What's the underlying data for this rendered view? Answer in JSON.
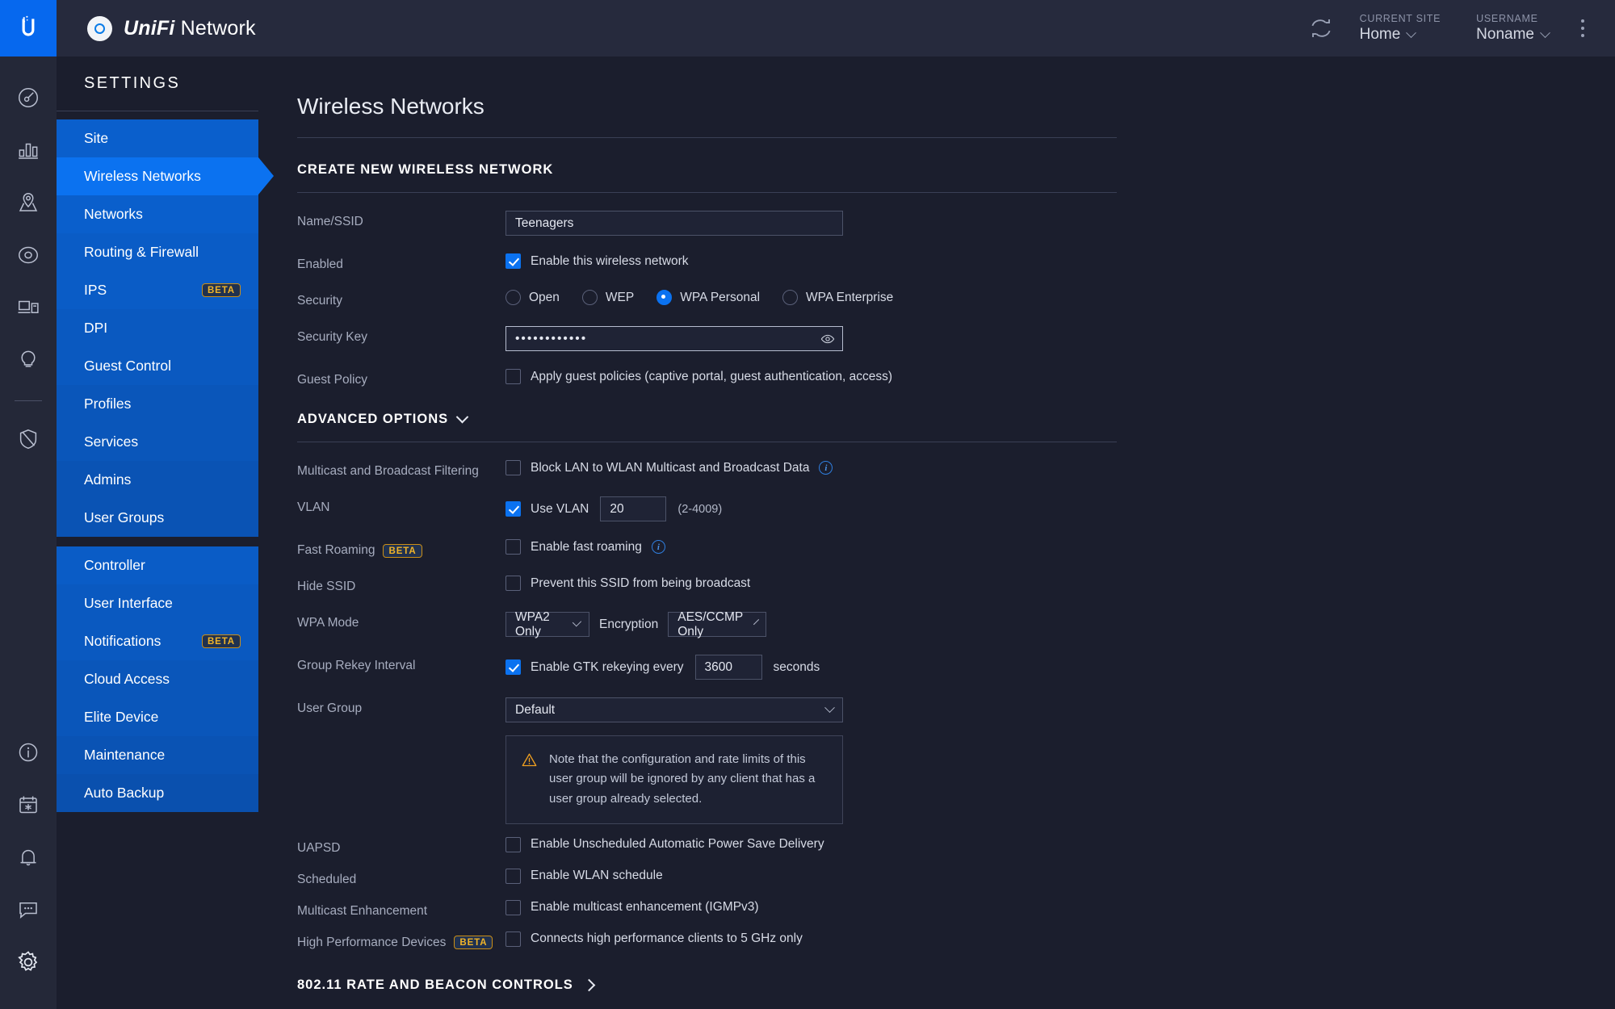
{
  "topbar": {
    "brand_bold": "UniFi",
    "brand_rest": " Network",
    "refresh_icon": "refresh-icon",
    "site_caption": "CURRENT SITE",
    "site_value": "Home",
    "user_caption": "USERNAME",
    "user_value": "Noname",
    "menu_icon": "kebab-menu-icon"
  },
  "rail": {
    "items": [
      {
        "name": "dashboard-icon"
      },
      {
        "name": "statistics-icon"
      },
      {
        "name": "map-icon"
      },
      {
        "name": "devices-icon"
      },
      {
        "name": "clients-icon"
      },
      {
        "name": "insights-icon"
      }
    ],
    "items_after_divider": [
      {
        "name": "threat-management-icon"
      }
    ],
    "bottom_items": [
      {
        "name": "info-icon"
      },
      {
        "name": "events-icon"
      },
      {
        "name": "alerts-icon"
      },
      {
        "name": "chat-icon"
      },
      {
        "name": "settings-gear-icon"
      }
    ]
  },
  "nav": {
    "title": "SETTINGS",
    "group1": [
      {
        "label": "Site",
        "badge": null,
        "active": false
      },
      {
        "label": "Wireless Networks",
        "badge": null,
        "active": true
      },
      {
        "label": "Networks",
        "badge": null,
        "active": false
      },
      {
        "label": "Routing & Firewall",
        "badge": null,
        "active": false
      },
      {
        "label": "IPS",
        "badge": "BETA",
        "active": false
      },
      {
        "label": "DPI",
        "badge": null,
        "active": false
      },
      {
        "label": "Guest Control",
        "badge": null,
        "active": false
      },
      {
        "label": "Profiles",
        "badge": null,
        "active": false
      },
      {
        "label": "Services",
        "badge": null,
        "active": false
      },
      {
        "label": "Admins",
        "badge": null,
        "active": false
      },
      {
        "label": "User Groups",
        "badge": null,
        "active": false
      }
    ],
    "group2": [
      {
        "label": "Controller",
        "badge": null,
        "active": false
      },
      {
        "label": "User Interface",
        "badge": null,
        "active": false
      },
      {
        "label": "Notifications",
        "badge": "BETA",
        "active": false
      },
      {
        "label": "Cloud Access",
        "badge": null,
        "active": false
      },
      {
        "label": "Elite Device",
        "badge": null,
        "active": false
      },
      {
        "label": "Maintenance",
        "badge": null,
        "active": false
      },
      {
        "label": "Auto Backup",
        "badge": null,
        "active": false
      }
    ]
  },
  "main": {
    "page_title": "Wireless Networks",
    "create_section_title": "CREATE NEW WIRELESS NETWORK",
    "name_label": "Name/SSID",
    "name_value": "Teenagers",
    "name_placeholder": "Name/SSID",
    "enabled_label": "Enabled",
    "enabled_checkbox_label": "Enable this wireless network",
    "enabled_checked": true,
    "security_label": "Security",
    "security_options": [
      {
        "label": "Open",
        "selected": false
      },
      {
        "label": "WEP",
        "selected": false
      },
      {
        "label": "WPA Personal",
        "selected": true
      },
      {
        "label": "WPA Enterprise",
        "selected": false
      }
    ],
    "security_key_label": "Security Key",
    "security_key_value": "••••••••••••",
    "security_key_reveal_icon": "eye-icon",
    "guest_policy_label": "Guest Policy",
    "guest_policy_checkbox_label": "Apply guest policies (captive portal, guest authentication, access)",
    "guest_policy_checked": false,
    "advanced_title": "ADVANCED OPTIONS",
    "advanced_chevron_icon": "chevron-down-icon",
    "multicast_label": "Multicast and Broadcast Filtering",
    "multicast_checkbox_label": "Block LAN to WLAN Multicast and Broadcast Data",
    "multicast_checked": false,
    "multicast_info_icon": "info-icon",
    "vlan_label": "VLAN",
    "vlan_checkbox_label": "Use VLAN",
    "vlan_checked": true,
    "vlan_value": "20",
    "vlan_range_hint": "(2-4009)",
    "fast_roaming_label": "Fast Roaming",
    "fast_roaming_badge": "BETA",
    "fast_roaming_checkbox_label": "Enable fast roaming",
    "fast_roaming_checked": false,
    "fast_roaming_info_icon": "info-icon",
    "hide_ssid_label": "Hide SSID",
    "hide_ssid_checkbox_label": "Prevent this SSID from being broadcast",
    "hide_ssid_checked": false,
    "wpa_mode_label": "WPA Mode",
    "wpa_mode_value": "WPA2 Only",
    "encryption_label": "Encryption",
    "encryption_value": "AES/CCMP Only",
    "rekey_label": "Group Rekey Interval",
    "rekey_checkbox_label": "Enable GTK rekeying every",
    "rekey_checked": true,
    "rekey_value": "3600",
    "rekey_unit": "seconds",
    "user_group_label": "User Group",
    "user_group_value": "Default",
    "note_icon": "warning-icon",
    "note_text": "Note that the configuration and rate limits of this user group will be ignored by any client that has a user group already selected.",
    "uapsd_label": "UAPSD",
    "uapsd_checkbox_label": "Enable Unscheduled Automatic Power Save Delivery",
    "uapsd_checked": false,
    "scheduled_label": "Scheduled",
    "scheduled_checkbox_label": "Enable WLAN schedule",
    "scheduled_checked": false,
    "multicast_enh_label": "Multicast Enhancement",
    "multicast_enh_checkbox_label": "Enable multicast enhancement (IGMPv3)",
    "multicast_enh_checked": false,
    "hpd_label": "High Performance Devices",
    "hpd_badge": "BETA",
    "hpd_checkbox_label": "Connects high performance clients to 5 GHz only",
    "hpd_checked": false,
    "rate_beacon_title": "802.11 RATE AND BEACON CONTROLS",
    "rate_beacon_chevron_icon": "chevron-right-icon"
  },
  "colors": {
    "accent": "#0b72f0",
    "nav_blue": "#0a5cc4",
    "bg": "#1b1e2d",
    "panel": "#262a3d",
    "beta": "#f0b429",
    "warning": "#f0a020"
  }
}
